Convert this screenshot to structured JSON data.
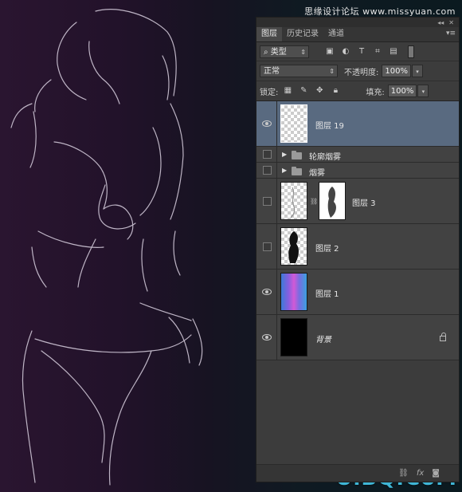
{
  "header_watermark": "思缘设计论坛 www.missyuan.com",
  "panel": {
    "collapse_glyph": "◂◂",
    "close_glyph": "✕",
    "tabs": [
      {
        "label": "图层",
        "active": true
      },
      {
        "label": "历史记录",
        "active": false
      },
      {
        "label": "通道",
        "active": false
      }
    ],
    "menu_glyph": "▾≡",
    "filter": {
      "label": "类型",
      "icons": [
        "image-filter-icon",
        "adjustment-filter-icon",
        "text-filter-icon",
        "shape-filter-icon",
        "smart-object-filter-icon"
      ]
    },
    "blend_mode": "正常",
    "opacity_label": "不透明度:",
    "opacity_value": "100%",
    "lock_label": "锁定:",
    "fill_label": "填充:",
    "fill_value": "100%",
    "layers": [
      {
        "name": "图层 19",
        "visible": true,
        "selected": true,
        "type": "pixel"
      },
      {
        "name": "轮廓烟雾",
        "visible": false,
        "selected": false,
        "type": "group"
      },
      {
        "name": "烟雾",
        "visible": false,
        "selected": false,
        "type": "group"
      },
      {
        "name": "图层 3",
        "visible": false,
        "selected": false,
        "type": "masked"
      },
      {
        "name": "图层 2",
        "visible": false,
        "selected": false,
        "type": "pixel"
      },
      {
        "name": "图层 1",
        "visible": true,
        "selected": false,
        "type": "gradient"
      },
      {
        "name": "背景",
        "visible": true,
        "selected": false,
        "type": "background",
        "locked": true
      }
    ],
    "bottom_icons": [
      "link-layers-icon",
      "fx-icon",
      "mask-icon"
    ]
  },
  "footer_watermark": {
    "ps": "PS",
    "site": "UiBQ.CoM"
  },
  "colors": {
    "panel_bg": "#3c3c3c",
    "selected_layer": "#596a80",
    "watermark": "#3fb6d6"
  }
}
